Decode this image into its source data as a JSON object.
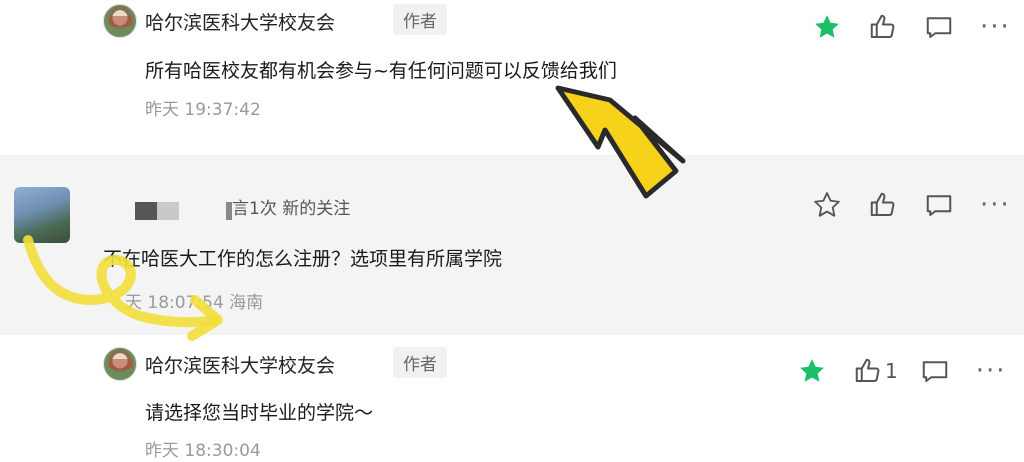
{
  "comments": [
    {
      "author": "哈尔滨医科大学校友会",
      "badge": "作者",
      "text": "所有哈医校友都有机会参与~有任何问题可以反馈给我们",
      "time": "昨天 19:37:42",
      "starred": true
    },
    {
      "author_meta": "言1次 新的关注",
      "text": "不在哈医大工作的怎么注册？选项里有所属学院",
      "time": "天 18:07:54",
      "location": "海南",
      "starred": false
    },
    {
      "author": "哈尔滨医科大学校友会",
      "badge": "作者",
      "text": "请选择您当时毕业的学院～",
      "time": "昨天 18:30:04",
      "starred": true,
      "like_count": "1"
    }
  ],
  "colors": {
    "star_active": "#1fbf6a",
    "arrow_fill": "#f6d31a",
    "arrow_stroke": "#2a2a2a",
    "highlight_yellow": "#f2de3a"
  },
  "icons": [
    "star-icon",
    "thumbs-up-icon",
    "comment-icon",
    "more-icon"
  ]
}
